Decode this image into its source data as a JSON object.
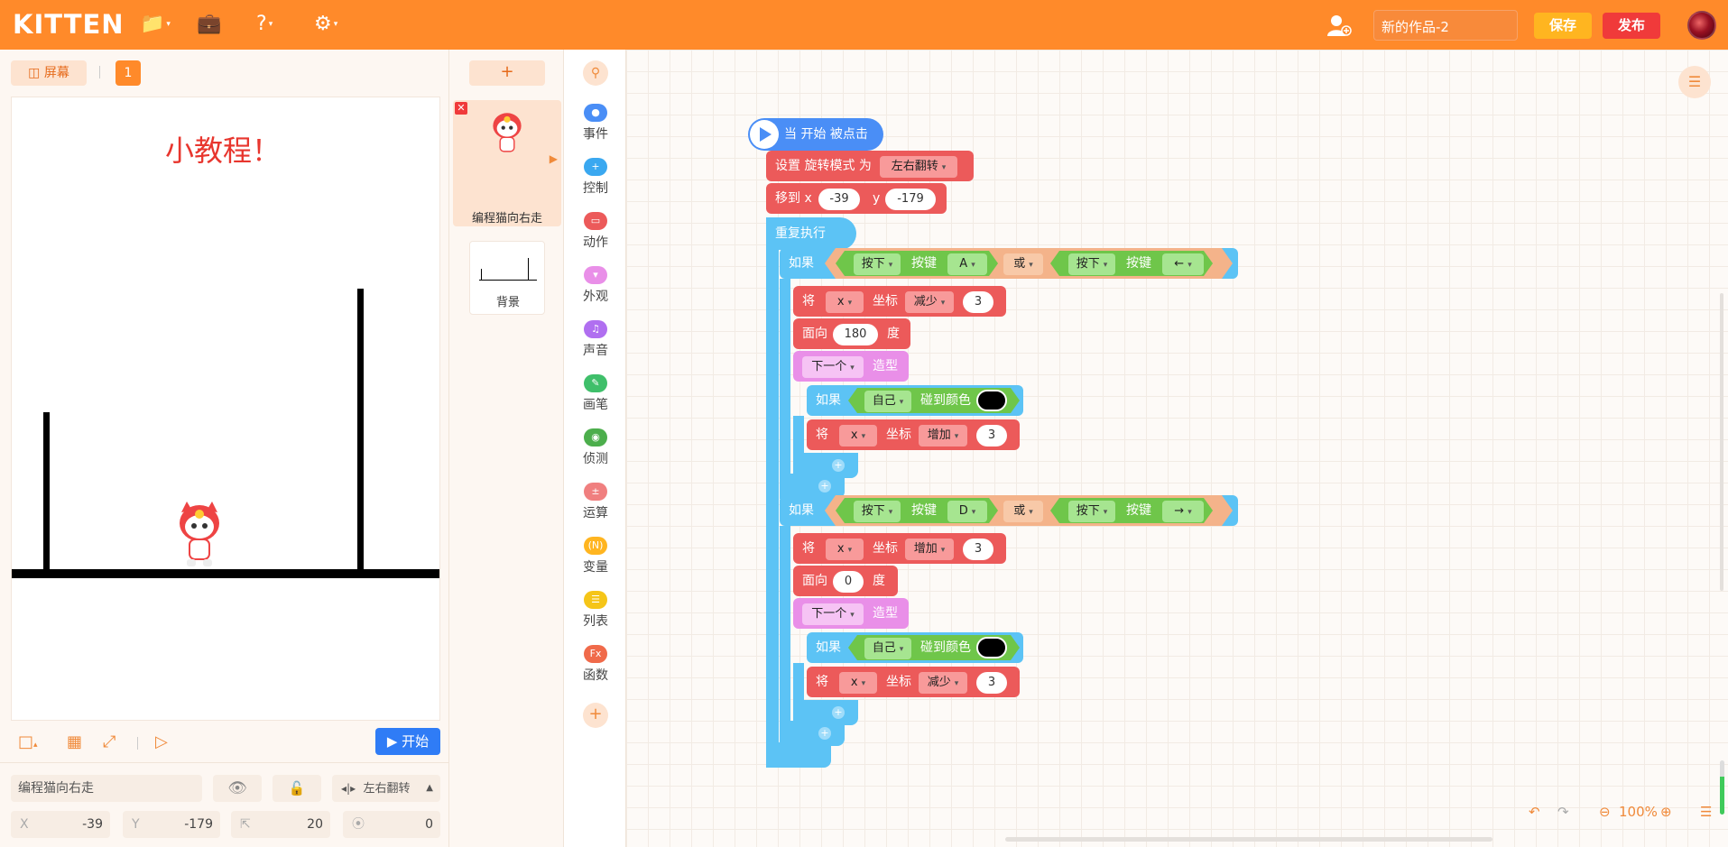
{
  "app": {
    "logo": "KITTEN",
    "project_name": "新的作品-2",
    "save_label": "保存",
    "publish_label": "发布"
  },
  "stage": {
    "screen_label": "屏幕",
    "page_number": "1",
    "title_text": "小教程！",
    "start_label": "开始"
  },
  "sprite_props": {
    "name": "编程猫向右走",
    "rotation_mode": "左右翻转",
    "x_label": "X",
    "x": "-39",
    "y_label": "Y",
    "y": "-179",
    "size": "20",
    "direction": "0"
  },
  "sprites": {
    "add_label": "+",
    "items": [
      {
        "name": "编程猫向右走"
      },
      {
        "name": "背景"
      }
    ]
  },
  "categories": [
    {
      "label": "事件",
      "color": "#4a8ef6",
      "icon": "flag-icon"
    },
    {
      "label": "控制",
      "color": "#3aa8f0",
      "icon": "control-icon"
    },
    {
      "label": "动作",
      "color": "#ec5a5a",
      "icon": "motion-icon"
    },
    {
      "label": "外观",
      "color": "#e98fe8",
      "icon": "shirt-icon"
    },
    {
      "label": "声音",
      "color": "#b06ff0",
      "icon": "music-icon"
    },
    {
      "label": "画笔",
      "color": "#3fbf6a",
      "icon": "pen-icon"
    },
    {
      "label": "侦测",
      "color": "#4cae4c",
      "icon": "detect-icon"
    },
    {
      "label": "运算",
      "color": "#f07f7f",
      "icon": "operator-icon"
    },
    {
      "label": "变量",
      "color": "#ffb520",
      "icon": "variable-icon"
    },
    {
      "label": "列表",
      "color": "#f5c518",
      "icon": "list-icon"
    },
    {
      "label": "函数",
      "color": "#f06a4a",
      "icon": "function-icon"
    }
  ],
  "blocks": {
    "hat": "当 开始 被点击",
    "set_rotation": "设置 旋转模式 为",
    "rotation_value": "左右翻转",
    "move_to": "移到 x",
    "move_x": "-39",
    "move_y_label": "y",
    "move_y": "-179",
    "forever": "重复执行",
    "if_label": "如果",
    "or_label": "或",
    "press": "按下",
    "key": "按键",
    "key_a": "A",
    "key_left": "←",
    "key_d": "D",
    "key_right": "→",
    "set_label": "将",
    "x_var": "x",
    "coord": "坐标",
    "decrease": "减少",
    "increase": "增加",
    "step": "3",
    "face": "面向",
    "deg_180": "180",
    "deg_0": "0",
    "degree": "度",
    "next": "下一个",
    "costume": "造型",
    "self": "自己",
    "touch_color": "碰到颜色"
  },
  "workspace": {
    "zoom": "100%"
  }
}
